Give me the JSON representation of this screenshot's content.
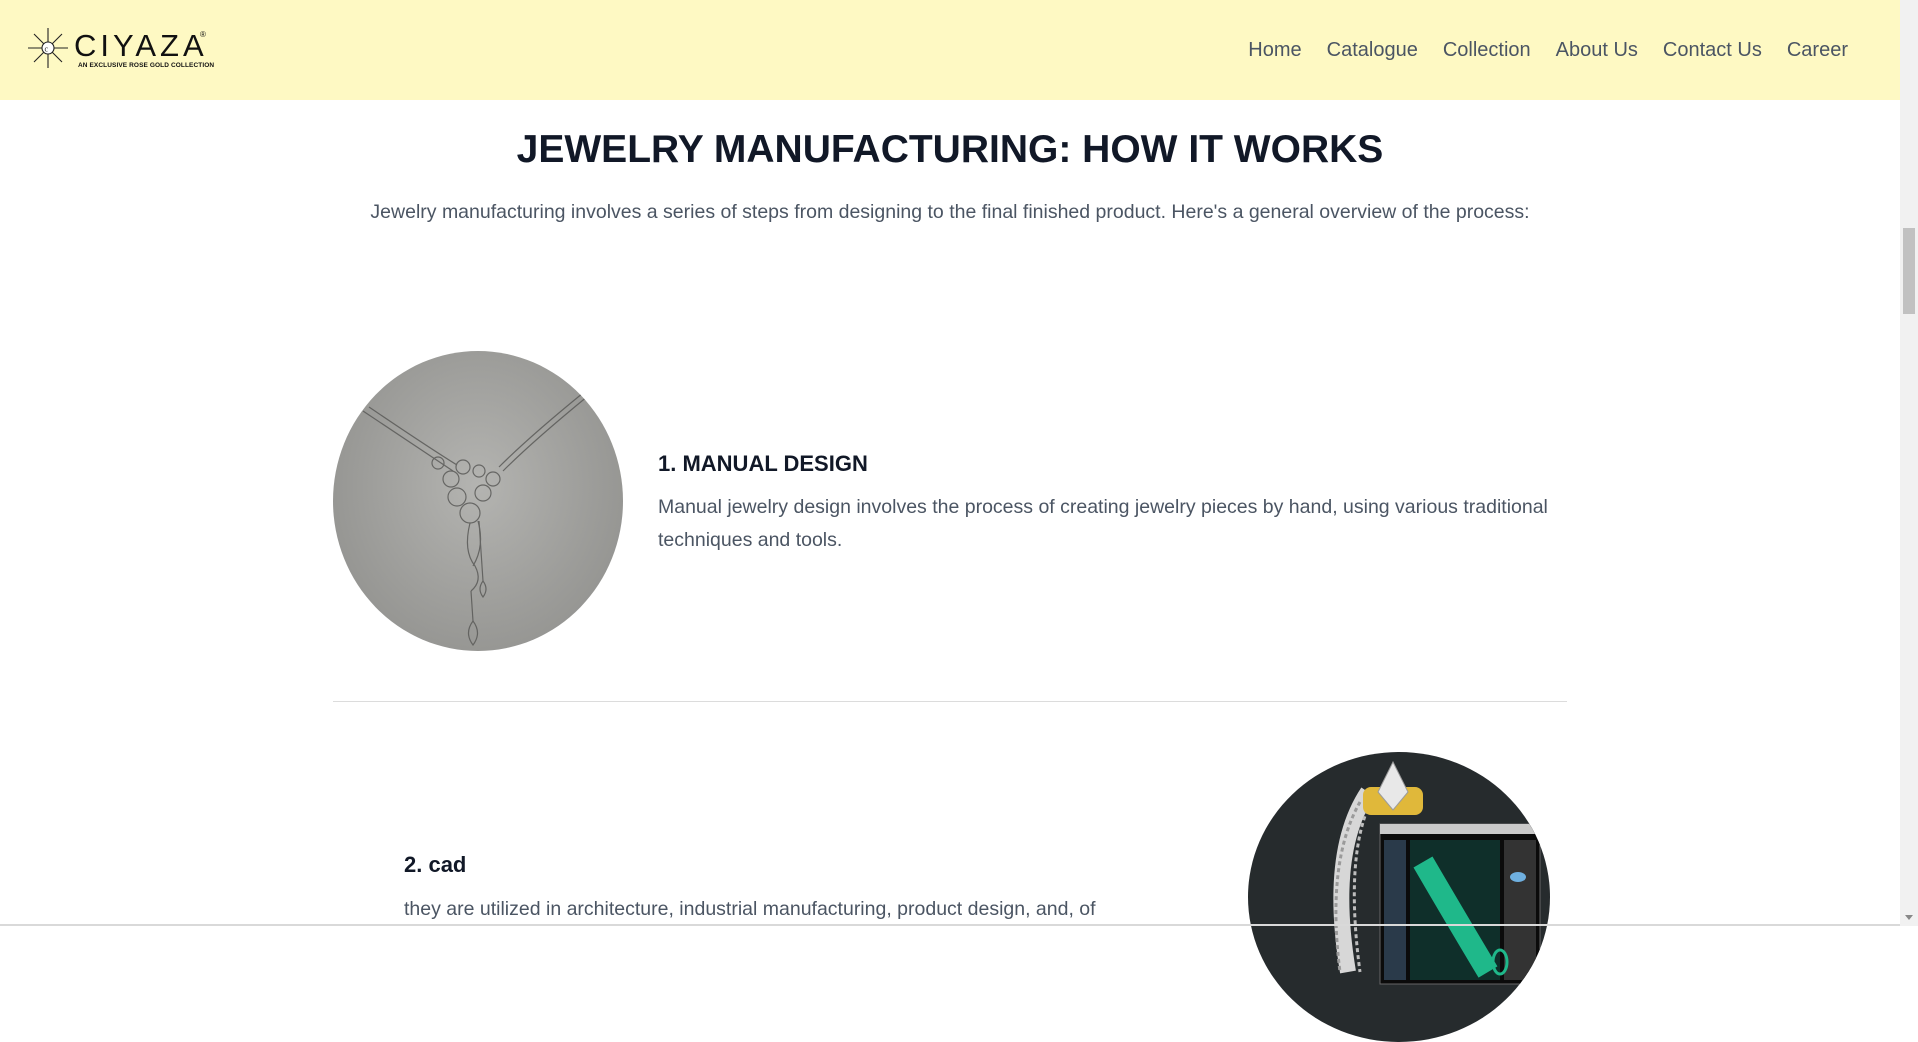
{
  "brand": {
    "name": "CIYAZA",
    "registered": "®",
    "tagline": "AN EXCLUSIVE ROSE GOLD COLLECTION"
  },
  "nav": {
    "items": [
      "Home",
      "Catalogue",
      "Collection",
      "About Us",
      "Contact Us",
      "Career"
    ]
  },
  "main": {
    "title": "JEWELRY MANUFACTURING: HOW IT WORKS",
    "intro": "Jewelry manufacturing involves a series of steps from designing to the final finished product. Here's a general overview of the process:",
    "steps": [
      {
        "title": "1. MANUAL DESIGN",
        "text": "Manual jewelry design involves the process of creating jewelry pieces by hand, using various traditional techniques and tools.",
        "image_icon": "necklace-sketch-image"
      },
      {
        "title": "2. cad",
        "text": "they are utilized in architecture, industrial manufacturing, product design, and, of",
        "image_icon": "cad-ring-render-image"
      }
    ]
  },
  "colors": {
    "header_bg": "#fef9c3",
    "title_color": "#111827",
    "body_text": "#4b5563"
  }
}
